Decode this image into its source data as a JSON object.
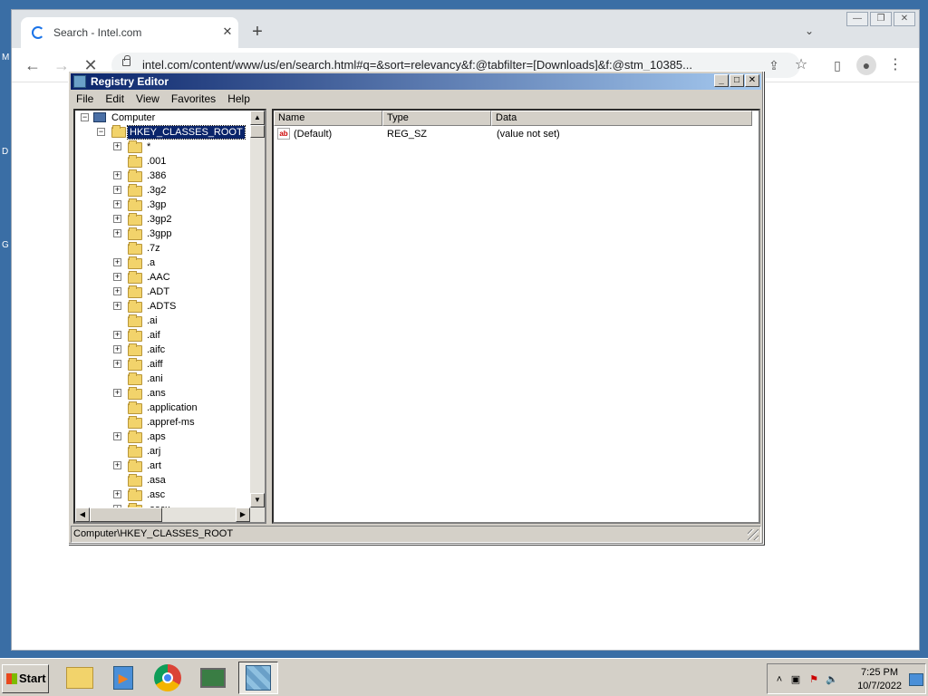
{
  "desktop": {
    "side_marks": [
      "M",
      "D",
      "G"
    ]
  },
  "browser": {
    "tab_title": "Search - Intel.com",
    "new_tab": "+",
    "url": "intel.com/content/www/us/en/search.html#q=&sort=relevancy&f:@tabfilter=[Downloads]&f:@stm_10385..."
  },
  "regedit": {
    "title": "Registry Editor",
    "menu": [
      "File",
      "Edit",
      "View",
      "Favorites",
      "Help"
    ],
    "tree": {
      "root": "Computer",
      "hive": "HKEY_CLASSES_ROOT",
      "items": [
        {
          "label": "*",
          "expandable": true
        },
        {
          "label": ".001",
          "expandable": false
        },
        {
          "label": ".386",
          "expandable": true
        },
        {
          "label": ".3g2",
          "expandable": true
        },
        {
          "label": ".3gp",
          "expandable": true
        },
        {
          "label": ".3gp2",
          "expandable": true
        },
        {
          "label": ".3gpp",
          "expandable": true
        },
        {
          "label": ".7z",
          "expandable": false
        },
        {
          "label": ".a",
          "expandable": true
        },
        {
          "label": ".AAC",
          "expandable": true
        },
        {
          "label": ".ADT",
          "expandable": true
        },
        {
          "label": ".ADTS",
          "expandable": true
        },
        {
          "label": ".ai",
          "expandable": false
        },
        {
          "label": ".aif",
          "expandable": true
        },
        {
          "label": ".aifc",
          "expandable": true
        },
        {
          "label": ".aiff",
          "expandable": true
        },
        {
          "label": ".ani",
          "expandable": false
        },
        {
          "label": ".ans",
          "expandable": true
        },
        {
          "label": ".application",
          "expandable": false
        },
        {
          "label": ".appref-ms",
          "expandable": false
        },
        {
          "label": ".aps",
          "expandable": true
        },
        {
          "label": ".arj",
          "expandable": false
        },
        {
          "label": ".art",
          "expandable": true
        },
        {
          "label": ".asa",
          "expandable": false
        },
        {
          "label": ".asc",
          "expandable": true
        },
        {
          "label": ".ascx",
          "expandable": true
        }
      ]
    },
    "columns": [
      "Name",
      "Type",
      "Data"
    ],
    "values": [
      {
        "name": "(Default)",
        "type": "REG_SZ",
        "data": "(value not set)"
      }
    ],
    "status": "Computer\\HKEY_CLASSES_ROOT"
  },
  "taskbar": {
    "start_label": "Start",
    "apps": [
      "folder-icon",
      "media-player-icon",
      "chrome-icon",
      "remote-desktop-icon",
      "regedit-icon"
    ],
    "clock": {
      "time": "7:25 PM",
      "date": "10/7/2022"
    }
  }
}
